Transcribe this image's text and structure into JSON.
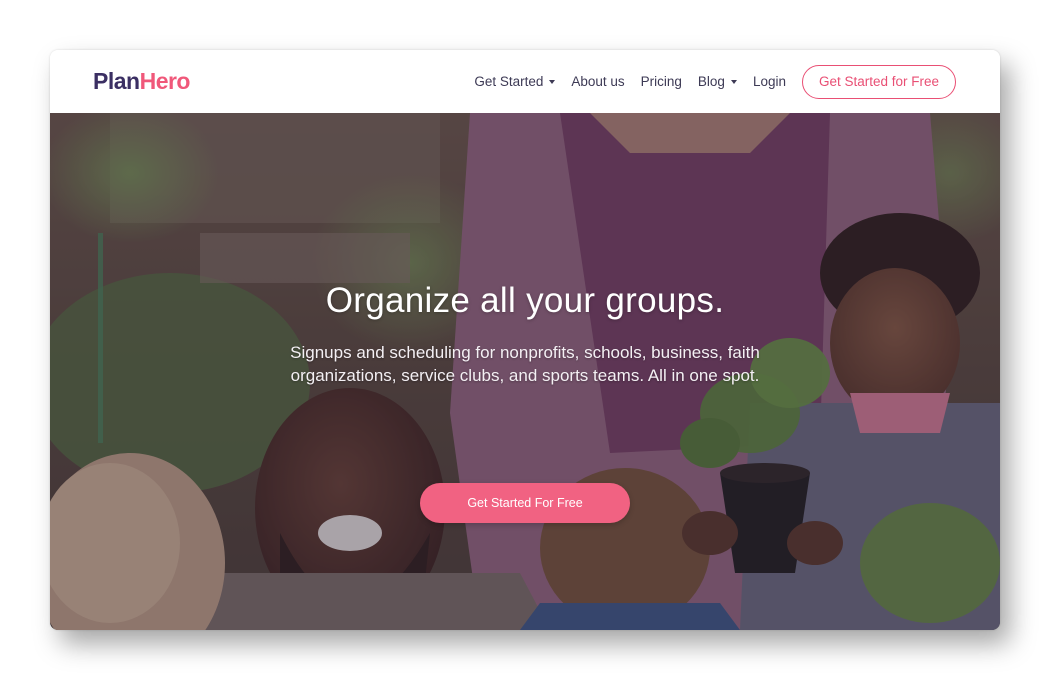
{
  "brand": {
    "name_part1": "Plan",
    "name_part2": "Hero",
    "colors": {
      "dark": "#3b2f63",
      "accent": "#f0587a"
    }
  },
  "nav": {
    "items": [
      {
        "label": "Get Started",
        "has_dropdown": true
      },
      {
        "label": "About us",
        "has_dropdown": false
      },
      {
        "label": "Pricing",
        "has_dropdown": false
      },
      {
        "label": "Blog",
        "has_dropdown": true
      },
      {
        "label": "Login",
        "has_dropdown": false
      }
    ],
    "cta_label": "Get Started for Free"
  },
  "hero": {
    "title": "Organize all your groups.",
    "subtitle": "Signups and scheduling for nonprofits, schools, business, faith organizations, service clubs, and sports teams. All in one spot.",
    "cta_label": "Get Started For Free",
    "cta_color": "#f16282"
  }
}
